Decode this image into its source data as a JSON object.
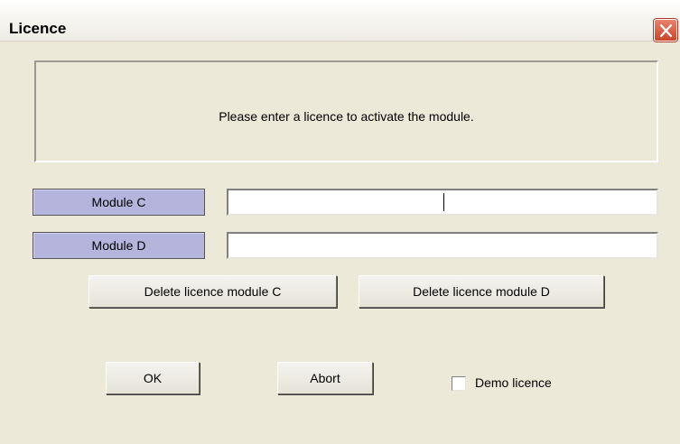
{
  "window": {
    "title": "Licence"
  },
  "info": {
    "message": "Please enter a licence to activate the module."
  },
  "modules": [
    {
      "label": "Module C",
      "value": ""
    },
    {
      "label": "Module D",
      "value": ""
    }
  ],
  "buttons": {
    "delete_c": "Delete licence module C",
    "delete_d": "Delete licence module D",
    "ok": "OK",
    "abort": "Abort"
  },
  "demo": {
    "label": "Demo licence",
    "checked": false
  },
  "icons": {
    "close": "close-icon"
  }
}
